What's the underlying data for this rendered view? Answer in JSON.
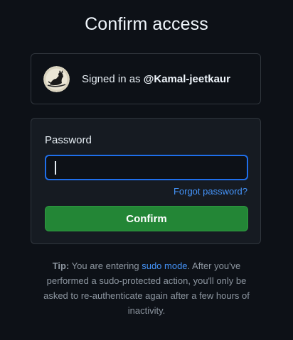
{
  "page": {
    "title": "Confirm access"
  },
  "account": {
    "signed_in_prefix": "Signed in as ",
    "username": "@Kamal-jeetkaur",
    "avatar_icon": "avatar-image"
  },
  "form": {
    "password_label": "Password",
    "password_value": "",
    "forgot_link": "Forgot password?",
    "confirm_label": "Confirm"
  },
  "tip": {
    "label": "Tip:",
    "text_before": " You are entering ",
    "link": "sudo mode",
    "text_after": ". After you've performed a sudo-protected action, you'll only be asked to re-authenticate again after a few hours of inactivity."
  },
  "colors": {
    "background": "#0d1117",
    "panel": "#161b22",
    "border": "#30363d",
    "accent_blue": "#4493f8",
    "focus_blue": "#1f6feb",
    "confirm_green": "#238636"
  }
}
